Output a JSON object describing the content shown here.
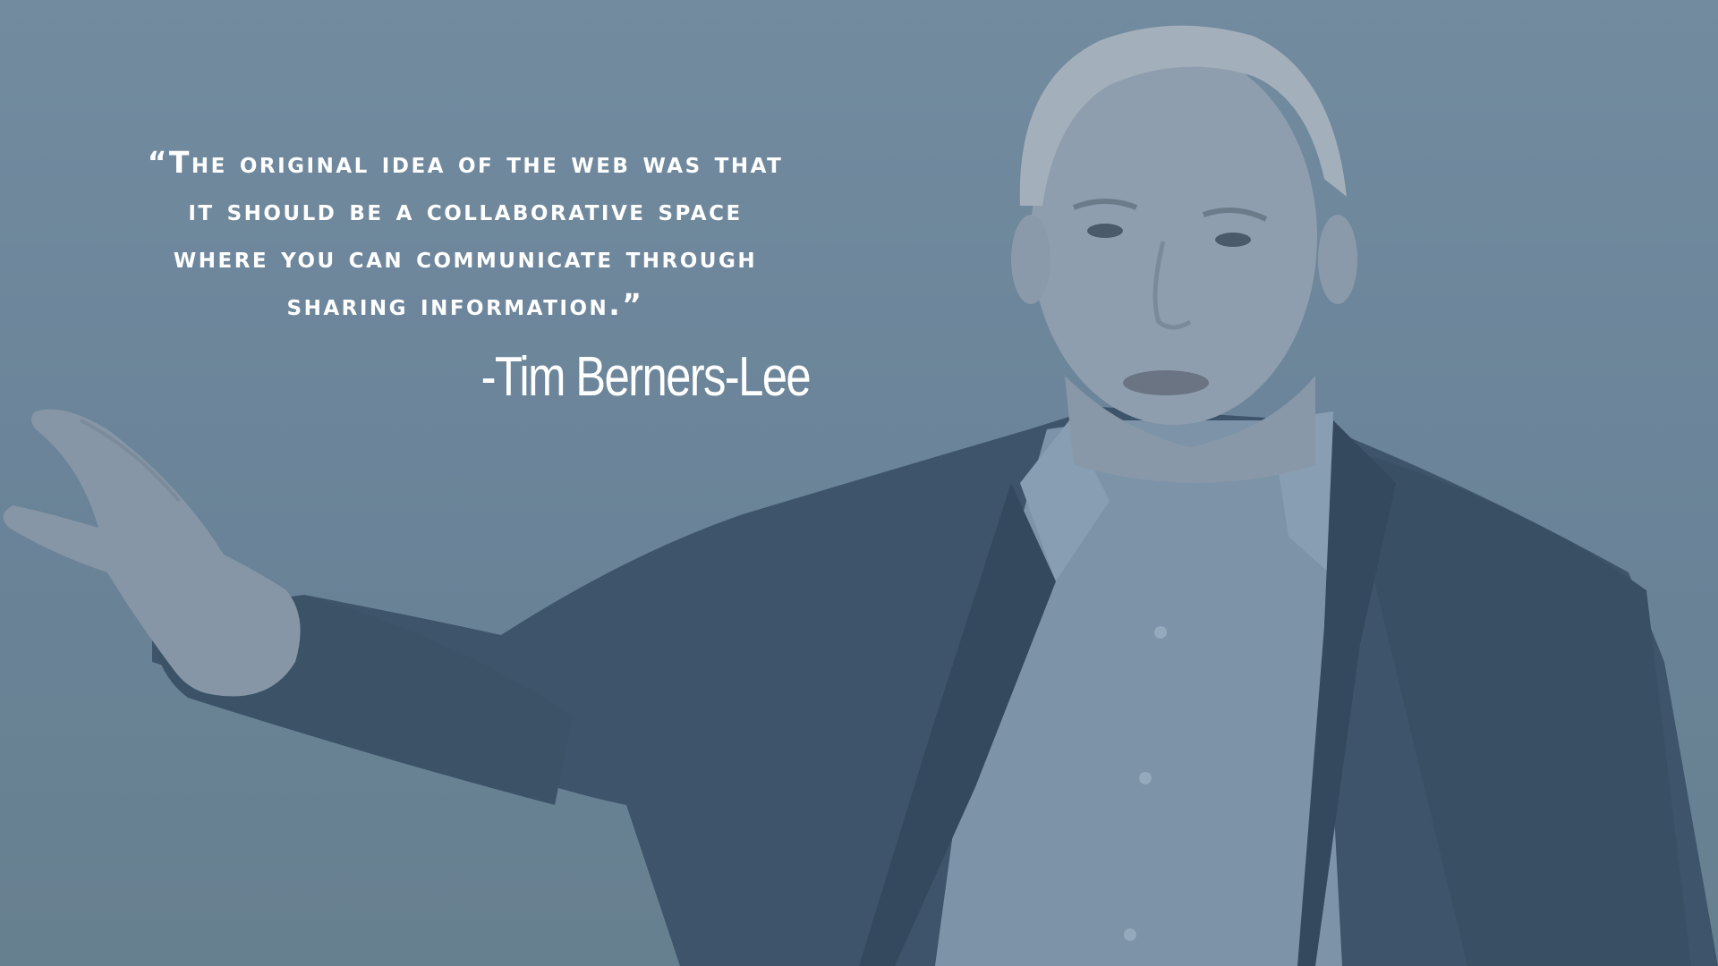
{
  "quote": {
    "lines": [
      "“The original idea of the web was that",
      "it should be a collaborative space",
      "where you can communicate through",
      "sharing information.”"
    ],
    "attribution": "-Tim Berners-Lee"
  },
  "colors": {
    "background": "#6d869b",
    "text": "#ffffff",
    "jacket": "#3f556b",
    "shirt": "#7d93a8",
    "skin": "#8f9fae"
  }
}
